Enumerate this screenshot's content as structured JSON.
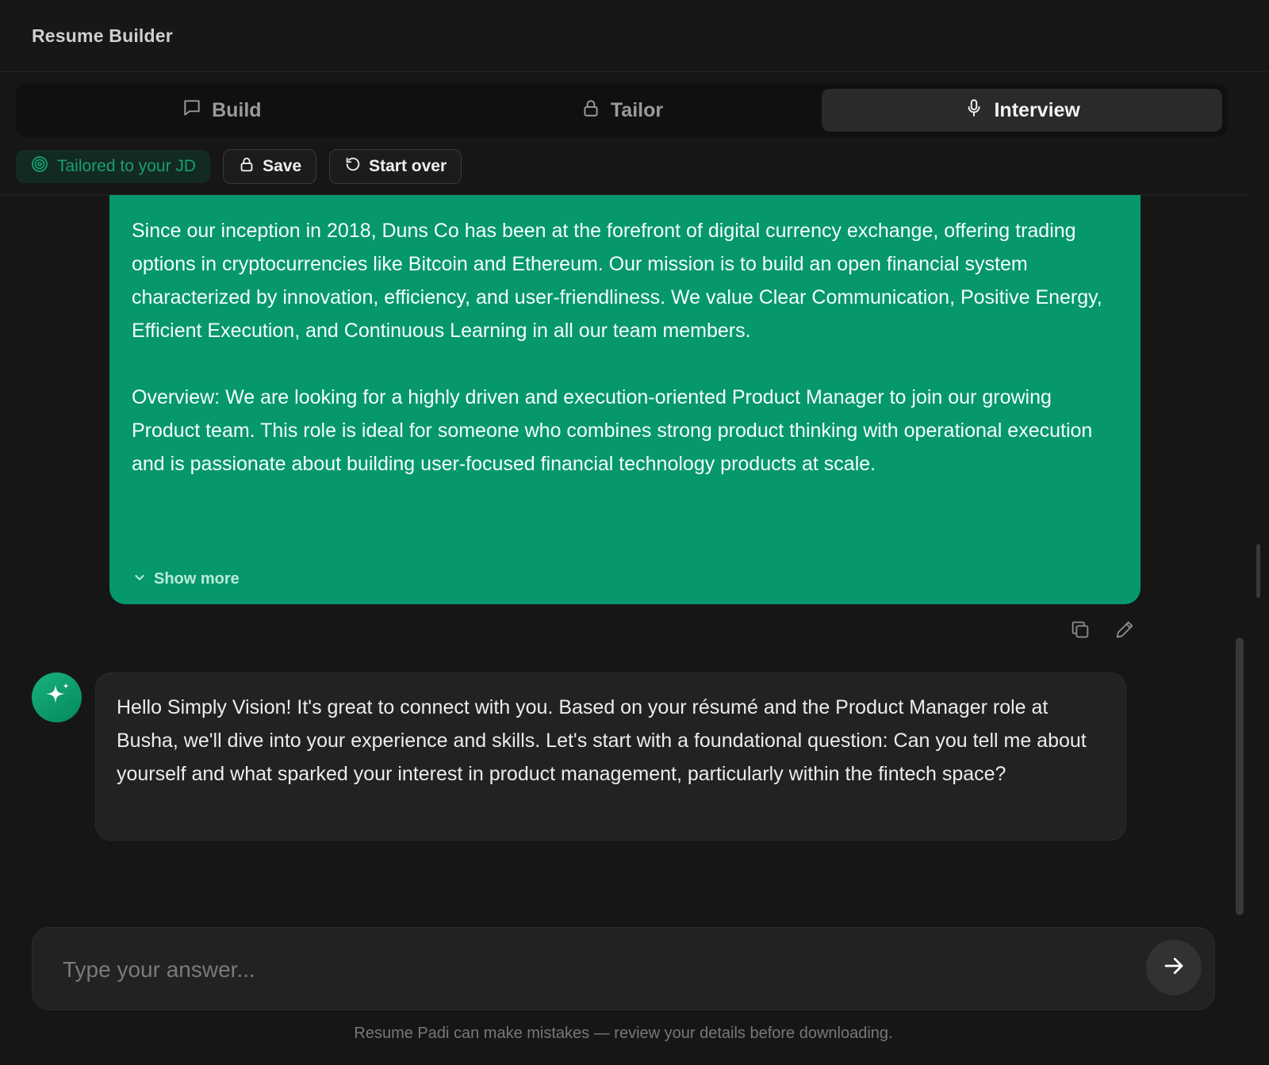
{
  "header": {
    "title": "Resume Builder"
  },
  "tabs": [
    {
      "label": "Build",
      "icon": "chat-bubble-icon"
    },
    {
      "label": "Tailor",
      "icon": "lock-icon"
    },
    {
      "label": "Interview",
      "icon": "microphone-icon",
      "active": true
    }
  ],
  "toolbar": {
    "badge_label": "Tailored to your JD",
    "save_label": "Save",
    "start_over_label": "Start over"
  },
  "messages": {
    "user": {
      "paragraphs": [
        "Since our inception in 2018, Duns Co has been at the forefront of digital currency exchange, offering trading options in cryptocurrencies like Bitcoin and Ethereum. Our mission is to build an open financial system characterized by innovation, efficiency, and user-friendliness. We value Clear Communication, Positive Energy, Efficient Execution, and Continuous Learning in all our team members.",
        "Overview: We are looking for a highly driven and execution-oriented Product Manager to join our growing Product team. This role is ideal for someone who combines strong product thinking with operational execution and is passionate about building user-focused financial technology products at scale."
      ],
      "show_more_label": "Show more"
    },
    "assistant": {
      "text": "Hello Simply Vision! It's great to connect with you. Based on your résumé and the Product Manager role at Busha, we'll dive into your experience and skills. Let's start with a foundational question: Can you tell me about yourself and what sparked your interest in product management, particularly within the fintech space?"
    }
  },
  "composer": {
    "placeholder": "Type your answer...",
    "value": ""
  },
  "footer": {
    "disclaimer": "Resume Padi can make mistakes — review your details before downloading."
  },
  "colors": {
    "accent": "#06976d",
    "background": "#161616",
    "bubble": "#222222"
  }
}
